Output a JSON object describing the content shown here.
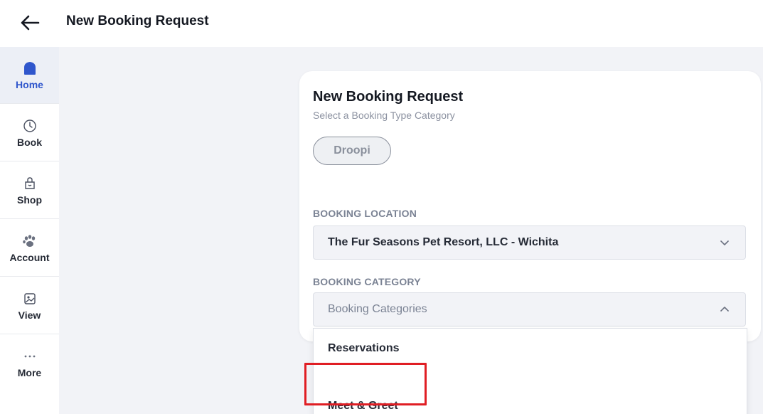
{
  "header": {
    "title": "New Booking Request"
  },
  "sidebar": {
    "items": [
      {
        "label": "Home",
        "icon": "home-icon",
        "active": true
      },
      {
        "label": "Book",
        "icon": "clock-icon"
      },
      {
        "label": "Shop",
        "icon": "shopping-bag-icon"
      },
      {
        "label": "Account",
        "icon": "paw-icon"
      },
      {
        "label": "View",
        "icon": "image-icon"
      },
      {
        "label": "More",
        "icon": "more-dots-icon"
      }
    ]
  },
  "card": {
    "title": "New Booking Request",
    "subtitle": "Select a Booking Type Category",
    "chip_label": "Droopi",
    "location": {
      "label": "BOOKING LOCATION",
      "value": "The Fur Seasons Pet Resort, LLC - Wichita"
    },
    "category": {
      "label": "BOOKING CATEGORY",
      "placeholder": "Booking Categories",
      "options": [
        "Reservations",
        "Meet & Greet"
      ]
    }
  },
  "colors": {
    "accent": "#2f56cc",
    "highlight": "#e01e24",
    "background": "#f2f3f7"
  }
}
